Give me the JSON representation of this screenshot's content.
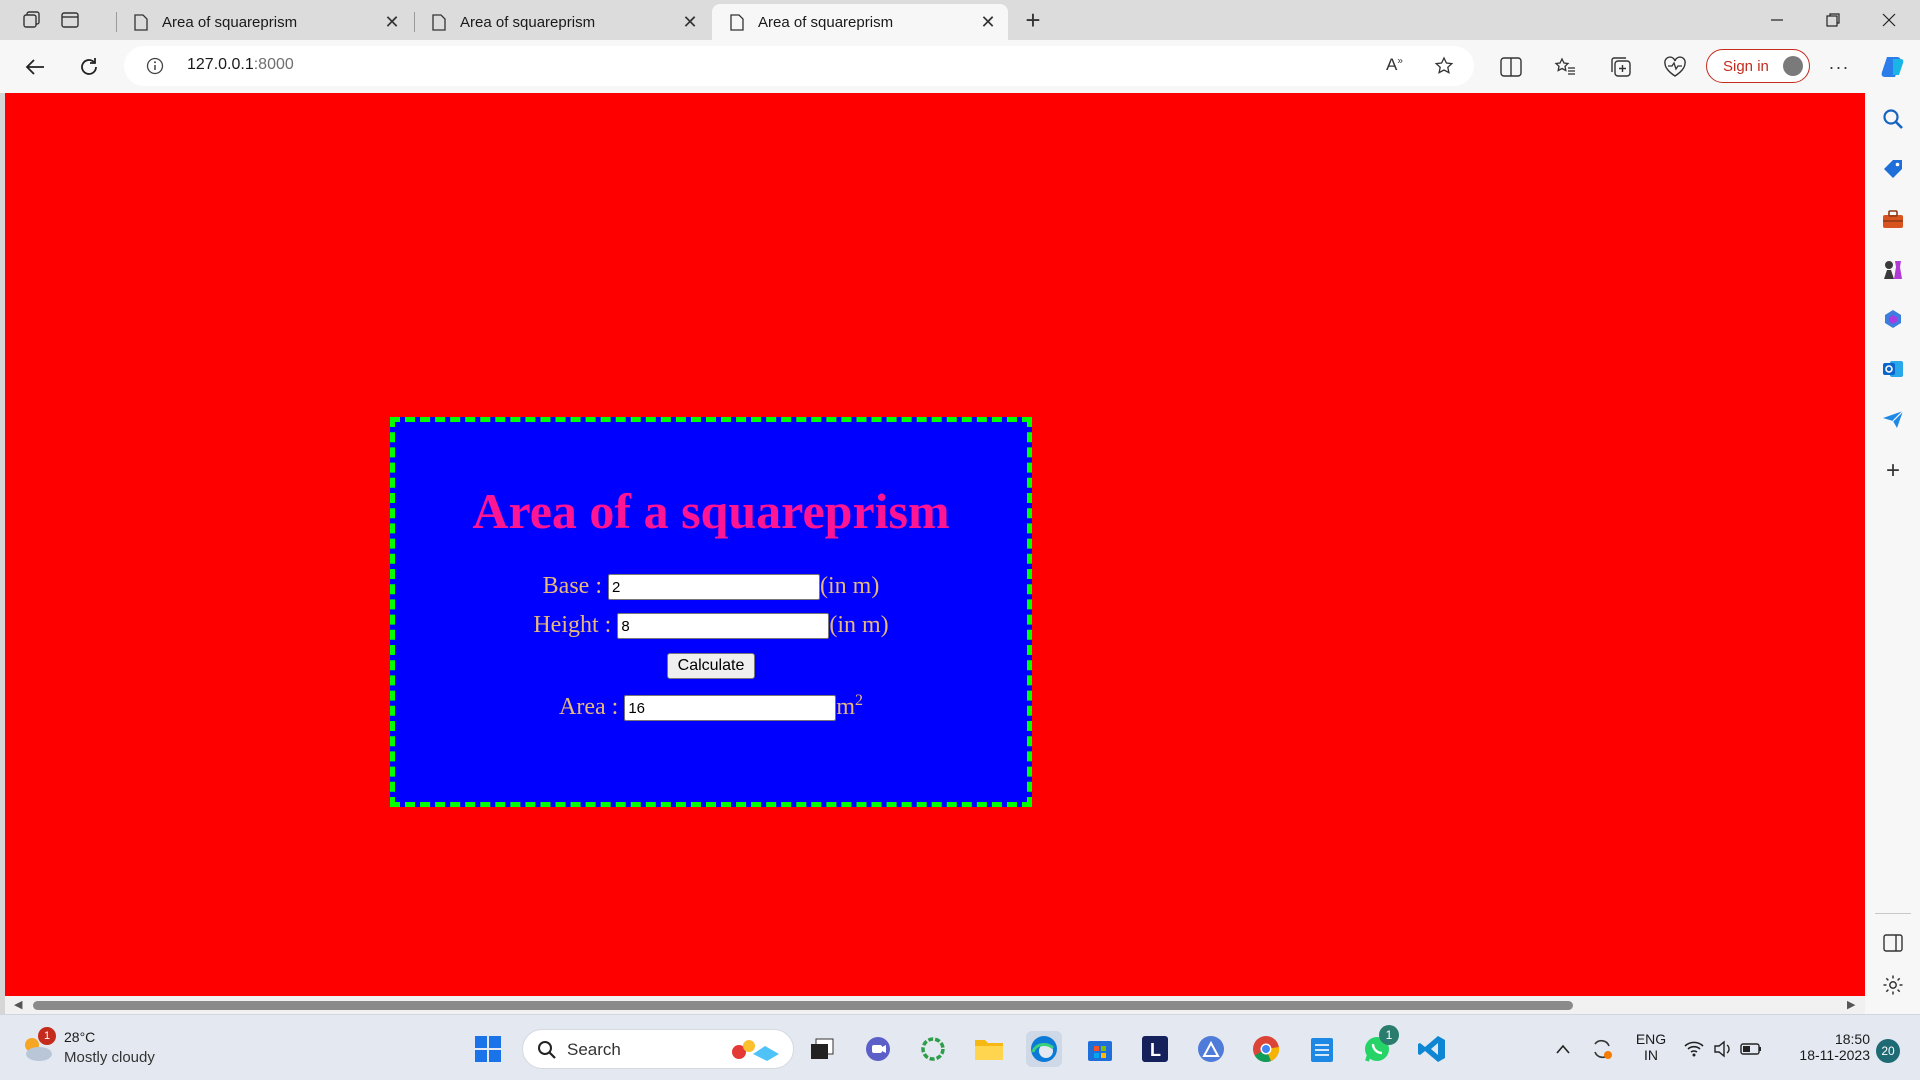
{
  "browser": {
    "tabs": [
      {
        "title": "Area of squareprism"
      },
      {
        "title": "Area of squareprism"
      },
      {
        "title": "Area of squareprism",
        "active": true
      }
    ],
    "url_host": "127.0.0.1",
    "url_port": ":8000",
    "sign_in_label": "Sign in"
  },
  "page": {
    "heading": "Area of a squareprism",
    "base_label": "Base :",
    "base_value": "2",
    "base_unit": "(in m)",
    "height_label": "Height :",
    "height_value": "8",
    "height_unit": "(in m)",
    "calculate_label": "Calculate",
    "area_label": "Area :",
    "area_value": "16",
    "area_unit": "m",
    "area_unit_exp": "2",
    "colors": {
      "page_bg": "#ff0000",
      "card_bg": "#0000ff",
      "card_border": "#00ff00",
      "heading": "#ff1493",
      "label": "#e6b87a"
    }
  },
  "taskbar": {
    "weather_badge": "1",
    "temperature": "28°C",
    "condition": "Mostly cloudy",
    "search_label": "Search",
    "whatsapp_badge": "1",
    "language_line1": "ENG",
    "language_line2": "IN",
    "time": "18:50",
    "date": "18-11-2023",
    "notification_count": "20"
  }
}
